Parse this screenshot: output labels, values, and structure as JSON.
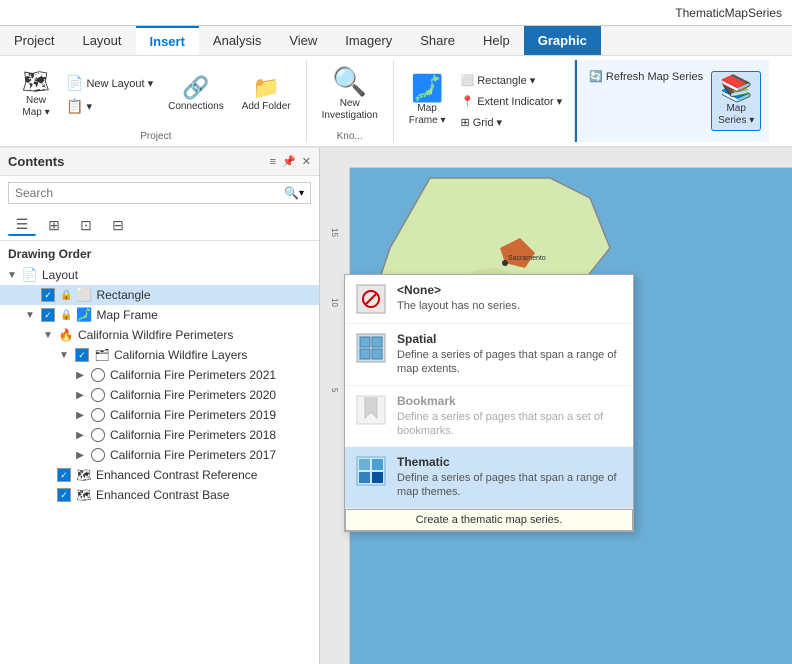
{
  "titlebar": {
    "appname": "ThematicMapSeries"
  },
  "ribbon": {
    "tabs": [
      {
        "id": "project",
        "label": "Project",
        "active": false
      },
      {
        "id": "layout",
        "label": "Layout",
        "active": false
      },
      {
        "id": "insert",
        "label": "Insert",
        "active": true
      },
      {
        "id": "analysis",
        "label": "Analysis",
        "active": false
      },
      {
        "id": "view",
        "label": "View",
        "active": false
      },
      {
        "id": "imagery",
        "label": "Imagery",
        "active": false
      },
      {
        "id": "share",
        "label": "Share",
        "active": false
      },
      {
        "id": "help",
        "label": "Help",
        "active": false
      },
      {
        "id": "graphic",
        "label": "Graphic",
        "active": false,
        "highlight": true
      }
    ],
    "groups": {
      "project": {
        "label": "Project",
        "buttons": [
          {
            "id": "new-map",
            "label": "New\nMap",
            "icon": "🗺"
          },
          {
            "id": "new-layout",
            "label": "New\nLayout",
            "icon": "📄"
          },
          {
            "id": "layers",
            "label": "",
            "icon": "📋"
          },
          {
            "id": "connections",
            "label": "Connections",
            "icon": "🔗"
          },
          {
            "id": "add-folder",
            "label": "Add\nFolder",
            "icon": "📁"
          }
        ]
      },
      "kno": {
        "label": "Kno...",
        "buttons": [
          {
            "id": "new-investigation",
            "label": "New\nInvestigation",
            "icon": "🔍"
          }
        ]
      },
      "insert_map": {
        "label": "",
        "buttons": [
          {
            "id": "map-frame",
            "label": "Map\nFrame",
            "icon": "🗾"
          },
          {
            "id": "rectangle",
            "label": "Rectangle",
            "icon": "⬜"
          },
          {
            "id": "extent-indicator",
            "label": "Extent Indicator",
            "icon": "📍"
          },
          {
            "id": "grid",
            "label": "Grid",
            "icon": "⊞"
          }
        ]
      },
      "graphic_group": {
        "label": "",
        "buttons": [
          {
            "id": "refresh-map-series",
            "label": "Refresh Map Series",
            "icon": "🔄"
          },
          {
            "id": "map-series",
            "label": "Map\nSeries",
            "icon": "📚"
          }
        ]
      }
    }
  },
  "dropdown": {
    "items": [
      {
        "id": "none",
        "title": "<None>",
        "desc": "The layout has no series.",
        "icon": "🚫",
        "selected": false,
        "disabled": false
      },
      {
        "id": "spatial",
        "title": "Spatial",
        "desc": "Define a series of pages that span a range of map extents.",
        "icon": "🗺",
        "selected": false,
        "disabled": false
      },
      {
        "id": "bookmark",
        "title": "Bookmark",
        "desc": "Define a series of pages that span a set of bookmarks.",
        "icon": "🔖",
        "selected": false,
        "disabled": true
      },
      {
        "id": "thematic",
        "title": "Thematic",
        "desc": "Define a series of pages that span a range of map themes.",
        "icon": "🎨",
        "selected": true,
        "disabled": false
      }
    ],
    "tooltip": "Create a thematic map series."
  },
  "contents": {
    "title": "Contents",
    "search_placeholder": "Search",
    "section": "Drawing Order",
    "tree": [
      {
        "id": "layout",
        "label": "Layout",
        "icon": "📄",
        "level": 0,
        "expanded": true,
        "checkbox": null,
        "children": [
          {
            "id": "rectangle",
            "label": "Rectangle",
            "icon": "⬜",
            "level": 1,
            "expanded": false,
            "checkbox": "checked",
            "selected": true
          },
          {
            "id": "map-frame",
            "label": "Map Frame",
            "icon": "🗾",
            "level": 1,
            "expanded": true,
            "checkbox": "checked",
            "children": [
              {
                "id": "ca-wildfire",
                "label": "California Wildfire Perimeters",
                "icon": "🔥",
                "level": 2,
                "expanded": true,
                "checkbox": null,
                "children": [
                  {
                    "id": "ca-wildfire-layers",
                    "label": "California Wildfire Layers",
                    "icon": "🗂",
                    "level": 3,
                    "expanded": true,
                    "checkbox": "checked",
                    "children": [
                      {
                        "id": "perimeters-2021",
                        "label": "California Fire Perimeters 2021",
                        "icon": "○",
                        "level": 4,
                        "checkbox": "radio",
                        "expanded": false
                      },
                      {
                        "id": "perimeters-2020",
                        "label": "California Fire Perimeters 2020",
                        "icon": "○",
                        "level": 4,
                        "checkbox": "radio",
                        "expanded": false
                      },
                      {
                        "id": "perimeters-2019",
                        "label": "California Fire Perimeters 2019",
                        "icon": "○",
                        "level": 4,
                        "checkbox": "radio",
                        "expanded": false
                      },
                      {
                        "id": "perimeters-2018",
                        "label": "California Fire Perimeters 2018",
                        "icon": "○",
                        "level": 4,
                        "checkbox": "radio",
                        "expanded": false
                      },
                      {
                        "id": "perimeters-2017",
                        "label": "California Fire Perimeters 2017",
                        "icon": "○",
                        "level": 4,
                        "checkbox": "radio",
                        "expanded": false
                      }
                    ]
                  }
                ]
              }
            ]
          },
          {
            "id": "enhanced-contrast-ref",
            "label": "Enhanced Contrast Reference",
            "icon": "🗺",
            "level": 1,
            "checkbox": "checked",
            "expanded": false
          },
          {
            "id": "enhanced-contrast-base",
            "label": "Enhanced Contrast Base",
            "icon": "🗺",
            "level": 1,
            "checkbox": "checked",
            "expanded": false
          }
        ]
      }
    ]
  }
}
